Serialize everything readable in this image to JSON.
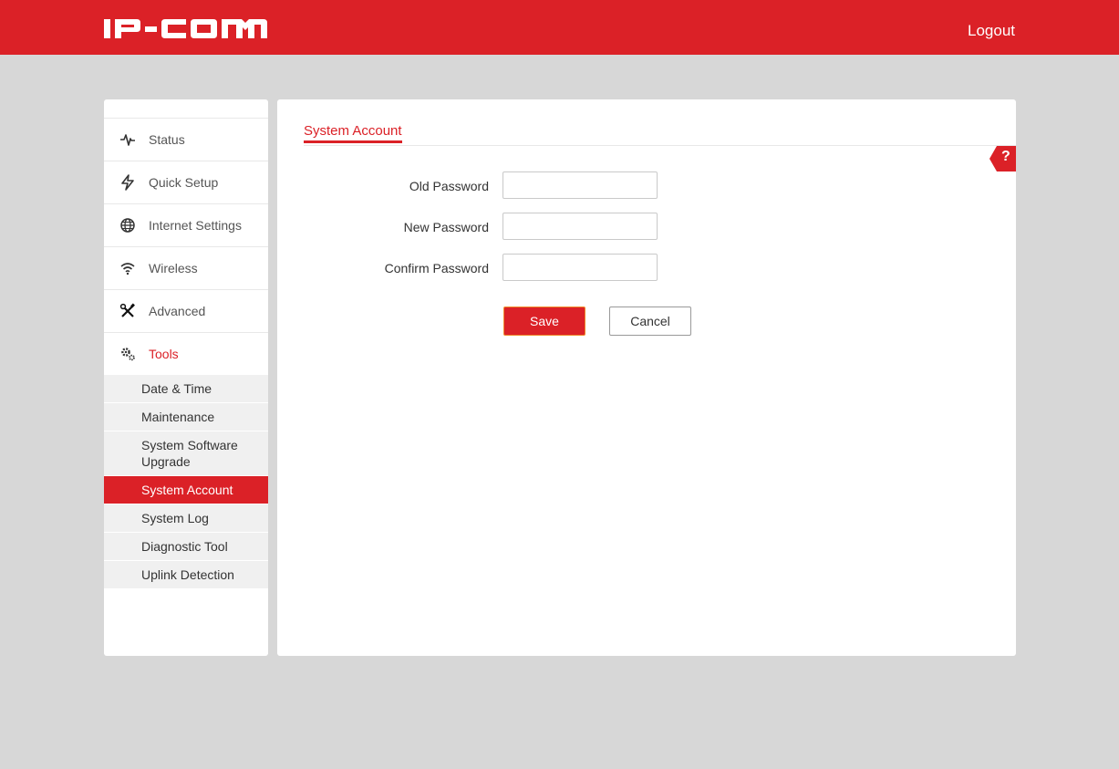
{
  "header": {
    "brand": "IP-COM",
    "logout_label": "Logout",
    "color": "#db2127"
  },
  "sidebar": {
    "items": [
      {
        "label": "Status",
        "icon": "pulse-icon"
      },
      {
        "label": "Quick Setup",
        "icon": "lightning-icon"
      },
      {
        "label": "Internet Settings",
        "icon": "globe-icon"
      },
      {
        "label": "Wireless",
        "icon": "wifi-icon"
      },
      {
        "label": "Advanced",
        "icon": "tools-icon"
      },
      {
        "label": "Tools",
        "icon": "gears-icon",
        "active": true
      }
    ],
    "subitems": [
      {
        "label": "Date & Time"
      },
      {
        "label": "Maintenance"
      },
      {
        "label": "System Software Upgrade"
      },
      {
        "label": "System Account",
        "active": true
      },
      {
        "label": "System Log"
      },
      {
        "label": "Diagnostic Tool"
      },
      {
        "label": "Uplink Detection"
      }
    ]
  },
  "main": {
    "tab_title": "System Account",
    "help_label": "?",
    "form": {
      "old_password_label": "Old Password",
      "old_password_value": "",
      "new_password_label": "New Password",
      "new_password_value": "",
      "confirm_password_label": "Confirm Password",
      "confirm_password_value": ""
    },
    "save_label": "Save",
    "cancel_label": "Cancel"
  }
}
